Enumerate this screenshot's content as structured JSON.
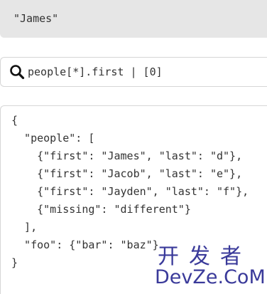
{
  "result": {
    "value": "\"James\""
  },
  "search": {
    "query": "people[*].first | [0]",
    "icon": "search-icon"
  },
  "json_input": {
    "text": "{\n  \"people\": [\n    {\"first\": \"James\", \"last\": \"d\"},\n    {\"first\": \"Jacob\", \"last\": \"e\"},\n    {\"first\": \"Jayden\", \"last\": \"f\"},\n    {\"missing\": \"different\"}\n  ],\n  \"foo\": {\"bar\": \"baz\"}\n}"
  },
  "watermark": {
    "cn": "开发者",
    "en": "DevZe.CoM",
    "color": "#3a3a9a"
  },
  "colors": {
    "result_bg": "#e6e6e6",
    "border": "#d6d6d6",
    "text": "#333333"
  }
}
